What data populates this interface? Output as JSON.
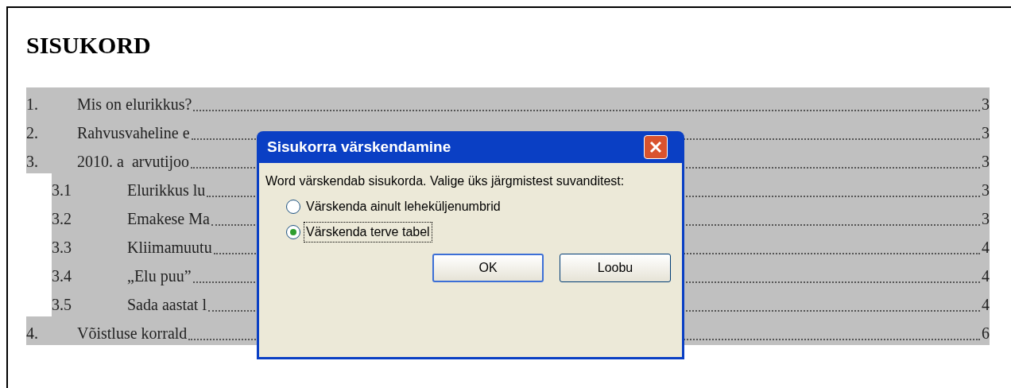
{
  "document": {
    "heading": "SISUKORD",
    "toc": [
      {
        "number": "1.",
        "title": "Mis on elurikkus?",
        "page": "3"
      },
      {
        "number": "2.",
        "title": "Rahvusvaheline e",
        "page": "3"
      },
      {
        "number": "3.",
        "title": "2010. a  arvutijoo",
        "page": "3",
        "children": [
          {
            "number": "3.1",
            "title": "Elurikkus lu",
            "page": "3"
          },
          {
            "number": "3.2",
            "title": "Emakese Ma",
            "page": "3"
          },
          {
            "number": "3.3",
            "title": "Kliimamuutu",
            "page": "4"
          },
          {
            "number": "3.4",
            "title": "„Elu puu”",
            "page": "4"
          },
          {
            "number": "3.5",
            "title": "Sada aastat l",
            "page": "4"
          }
        ]
      },
      {
        "number": "4.",
        "title": "Võistluse korrald",
        "page": "6"
      }
    ]
  },
  "dialog": {
    "title": "Sisukorra värskendamine",
    "message": "Word värskendab sisukorda. Valige üks järgmistest suvanditest:",
    "options": [
      {
        "label": "Värskenda ainult leheküljenumbrid",
        "selected": false
      },
      {
        "label": "Värskenda terve tabel",
        "selected": true
      }
    ],
    "buttons": [
      {
        "label": "OK",
        "default": true
      },
      {
        "label": "Loobu",
        "default": false
      }
    ]
  }
}
